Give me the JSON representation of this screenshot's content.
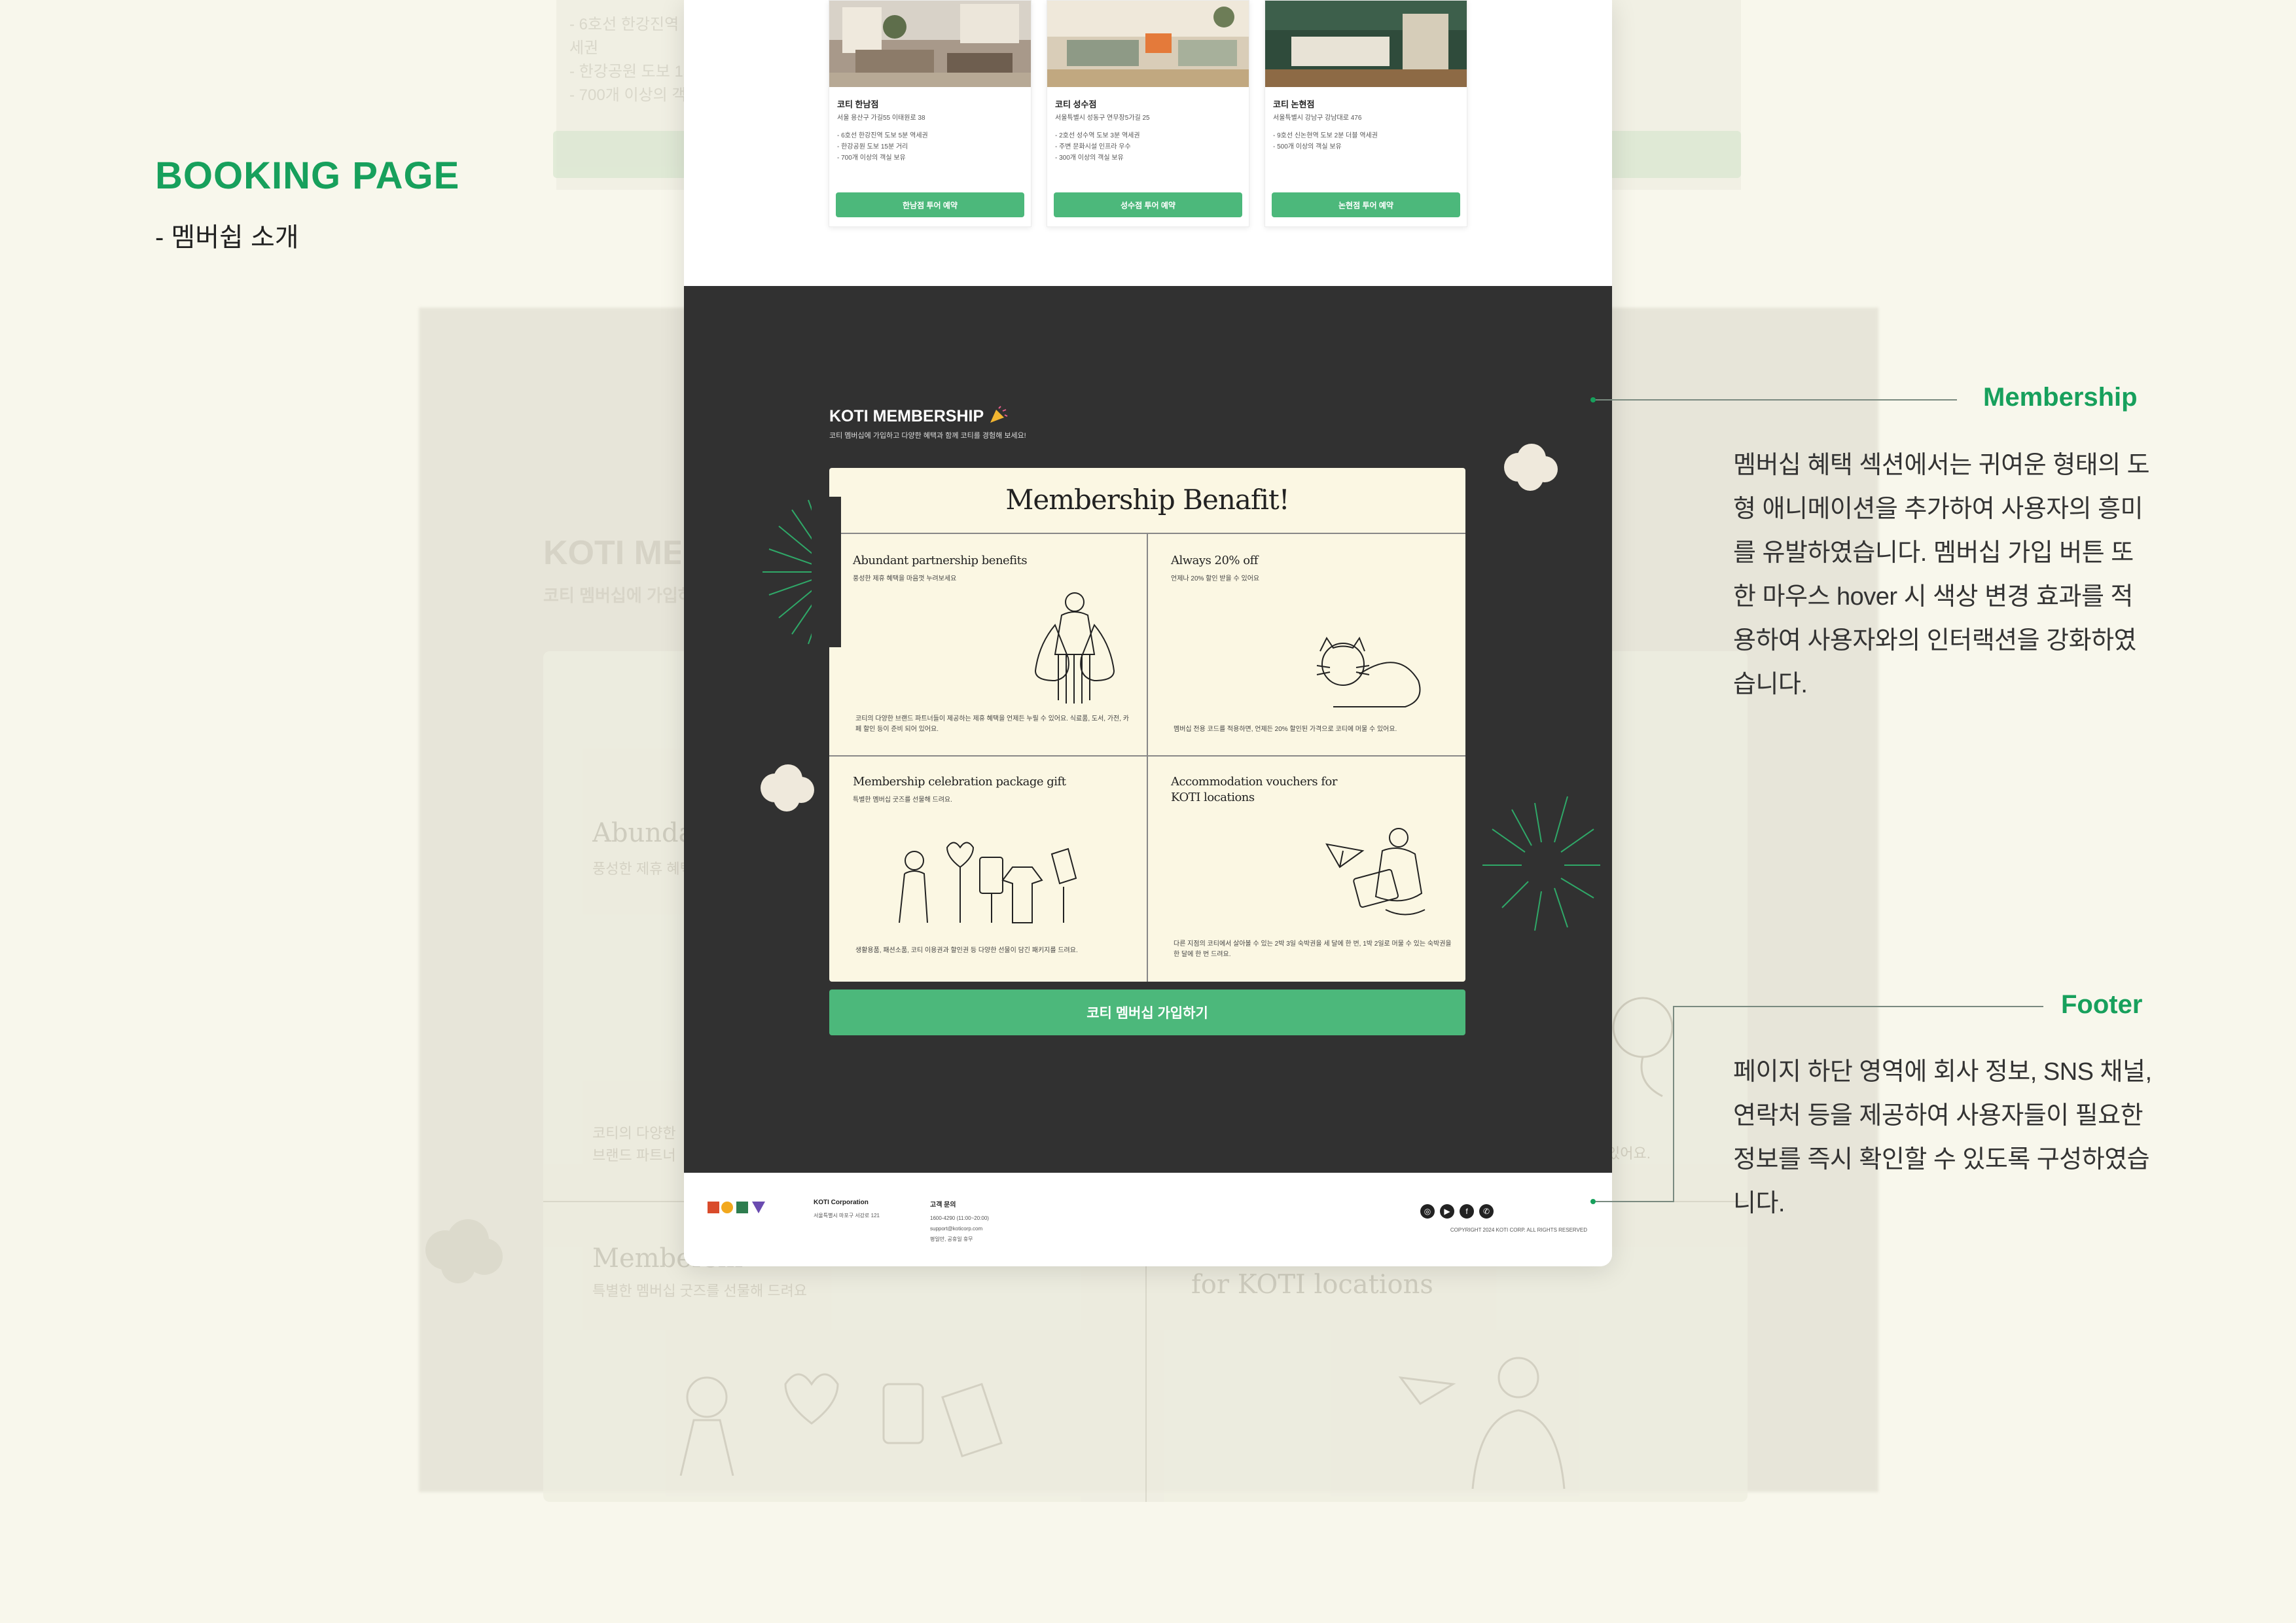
{
  "header": {
    "title": "BOOKING PAGE",
    "subtitle": "- 멤버쉽 소개"
  },
  "branches": [
    {
      "name": "코티 한남점",
      "address": "서울 용산구 가길55 이태원로 38",
      "features": [
        "- 6호선 한강진역 도보 5분 역세권",
        "- 한강공원 도보 15분 거리",
        "- 700개 이상의 객실 보유"
      ],
      "button": "한남점 투어 예약"
    },
    {
      "name": "코티 성수점",
      "address": "서울특별시 성동구 연무장5가길 25",
      "features": [
        "- 2호선 성수역 도보 3분 역세권",
        "- 주변 문화시설 인프라 우수",
        "- 300개 이상의 객실 보유"
      ],
      "button": "성수점 투어 예약"
    },
    {
      "name": "코티 논현점",
      "address": "서울특별시 강남구 강남대로 476",
      "features": [
        "- 9호선 신논현역 도보 2분 더블 역세권",
        "- 500개 이상의 객실 보유"
      ],
      "button": "논현점 투어 예약"
    }
  ],
  "membership": {
    "title": "KOTI MEMBERSHIP",
    "subtitle": "코티 멤버십에 가입하고 다양한 혜택과 함께 코티를 경험해 보세요!",
    "board_title": "Membership Benafit!",
    "benefits": [
      {
        "title": "Abundant partnership benefits",
        "sub": "풍성한 제휴 혜택을 마음껏 누려보세요",
        "desc": "코티의 다양한 브랜드 파트너들이 제공하는 제휴 혜택을 언제든 누릴 수 있어요. 식료품, 도서, 가전, 카페 할인 등이 준비 되어 있어요."
      },
      {
        "title": "Always 20% off",
        "sub": "언제나 20% 할인 받을 수 있어요",
        "desc": "멤버십 전용 코드를 적용하면, 언제든 20% 할인된 가격으로 코티에 머물 수 있어요."
      },
      {
        "title": "Membership celebration package gift",
        "sub": "특별한 멤버십 굿즈를 선물해 드려요.",
        "desc": "생활용품, 패션소품, 코티 이용권과 할인권 등 다양한 선물이 담긴 패키지를 드려요."
      },
      {
        "title": "Accommodation vouchers for KOTI locations",
        "sub": "",
        "desc": "다른 지점의 코티에서 살아볼 수 있는 2박 3일 숙박권을 세 달에 한 번, 1박 2일로 머물 수 있는 숙박권을 한 달에 한 번 드려요."
      }
    ],
    "join_button": "코티 멤버십 가입하기"
  },
  "footer": {
    "logo": "KOTI",
    "company": "KOTI Corporation",
    "address": "서울특별시 마포구 서강로 121",
    "cs_title": "고객 문의",
    "cs_lines": [
      "1600-4290 (11:00~20:00)",
      "support@koticorp.com",
      "평일만, 공휴일 휴무"
    ],
    "copyright": "COPYRIGHT 2024 KOTI CORP. ALL RIGHTS RESERVED",
    "sns_icons": [
      "instagram-icon",
      "youtube-icon",
      "facebook-icon",
      "whatsapp-icon"
    ]
  },
  "annotations": {
    "membership_label": "Membership",
    "membership_text": "멤버십 혜택 섹션에서는 귀여운 형태의 도형 애니메이션을 추가하여 사용자의 흥미를 유발하였습니다. 멤버십 가입 버튼 또한 마우스 hover 시 색상 변경 효과를 적용하여 사용자와의 인터랙션을 강화하였습니다.",
    "footer_label": "Footer",
    "footer_text": "페이지 하단 영역에 회사 정보, SNS 채널, 연락처 등을 제공하여 사용자들이 필요한 정보를 즉시 확인할 수 있도록 구성하였습니다."
  },
  "ghost": {
    "title": "KOTI MEMBERSHIP",
    "subtitle": "코티 멤버십에 가입하고 다양한 혜택과 함께 코티를 경험해 보세요!",
    "cell_a": "Abundant partnership benefits",
    "cell_a_sub": "풍성한 제휴 혜택을 마음껏 누려보세요",
    "cell_c": "Membership celebration package gift",
    "cell_c_sub": "특별한 멤버십 굿즈를 선물해 드려요.",
    "cell_d": "for KOTI locations",
    "cell_a_desc": "코티의 다양한 브랜드 파트너들이 제공하는 제휴 혜택을 언제든 누릴 수 있어요. 식료품, 도서, 가전, 카페 할인 등이 준비 되어 있어요."
  },
  "colors": {
    "accent": "#17a05c",
    "button": "#4cb87b",
    "dark_section": "#313131",
    "board": "#fbf7e3",
    "page_bg": "#f8f7ec"
  }
}
